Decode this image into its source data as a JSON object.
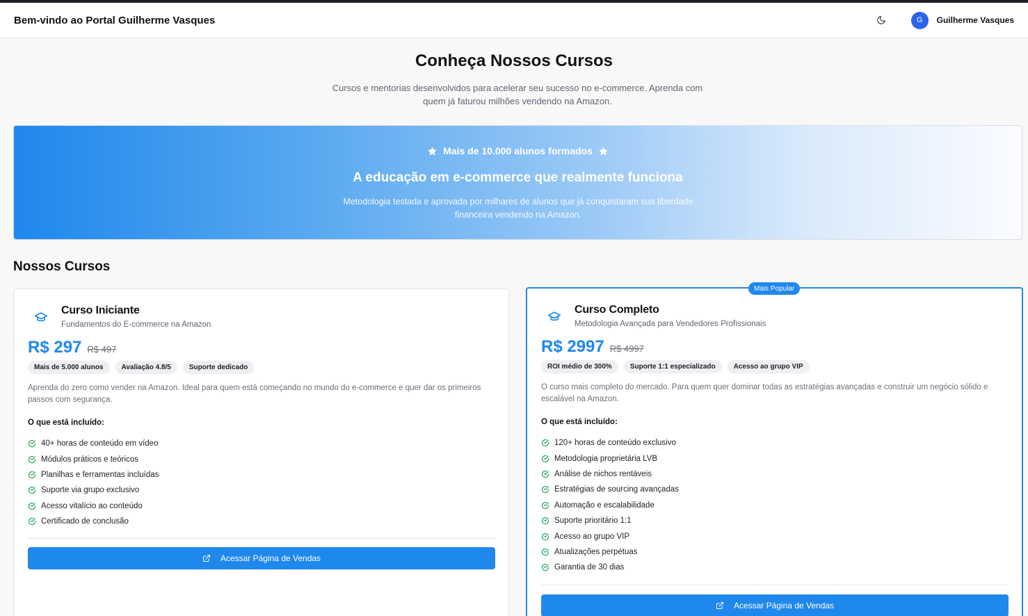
{
  "header": {
    "title": "Bem-vindo ao Portal Guilherme Vasques",
    "theme_icon": "moon-icon",
    "avatar_initial": "G",
    "user_name": "Guilherme Vasques"
  },
  "intro": {
    "title": "Conheça Nossos Cursos",
    "subtitle": "Cursos e mentorias desenvolvidos para acelerar seu sucesso no e-commerce. Aprenda com quem já faturou milhões vendendo na Amazon."
  },
  "hero": {
    "badge": "Mais de 10.000 alunos formados",
    "title": "A educação em e-commerce que realmente funciona",
    "text": "Metodologia testada e aprovada por milhares de alunos que já conquistaram sua liberdade financeira vendendo na Amazon."
  },
  "section_title": "Nossos Cursos",
  "courses": [
    {
      "name": "Curso Iniciante",
      "subtitle": "Fundamentos do E-commerce na Amazon",
      "price": "R$ 297",
      "old_price": "R$ 497",
      "tags": [
        "Mais de 5.000 alunos",
        "Avaliação 4.8/5",
        "Suporte dedicado"
      ],
      "description": "Aprenda do zero como vender na Amazon. Ideal para quem está começando no mundo do e-commerce e quer dar os primeiros passos com segurança.",
      "included_label": "O que está incluído:",
      "features": [
        "40+ horas de conteúdo em vídeo",
        "Módulos práticos e teóricos",
        "Planilhas e ferramentas incluídas",
        "Suporte via grupo exclusivo",
        "Acesso vitalício ao conteúdo",
        "Certificado de conclusão"
      ],
      "cta": "Acessar Página de Vendas"
    },
    {
      "badge": "Mais Popular",
      "name": "Curso Completo",
      "subtitle": "Metodologia Avançada para Vendedores Profissionais",
      "price": "R$ 2997",
      "old_price": "R$ 4997",
      "tags": [
        "ROI médio de 300%",
        "Suporte 1:1 especializado",
        "Acesso ao grupo VIP"
      ],
      "description": "O curso mais completo do mercado. Para quem quer dominar todas as estratégias avançadas e construir um negócio sólido e escalável na Amazon.",
      "included_label": "O que está incluído:",
      "features": [
        "120+ horas de conteúdo exclusivo",
        "Metodologia proprietária LVB",
        "Análise de nichos rentáveis",
        "Estratégias de sourcing avançadas",
        "Automação e escalabilidade",
        "Suporte prioritário 1:1",
        "Acesso ao grupo VIP",
        "Atualizações perpétuas",
        "Garantia de 30 dias"
      ],
      "cta": "Acessar Página de Vendas"
    }
  ],
  "colors": {
    "accent": "#1f88ec",
    "check": "#22a559",
    "avatar": "#2b64e8"
  }
}
